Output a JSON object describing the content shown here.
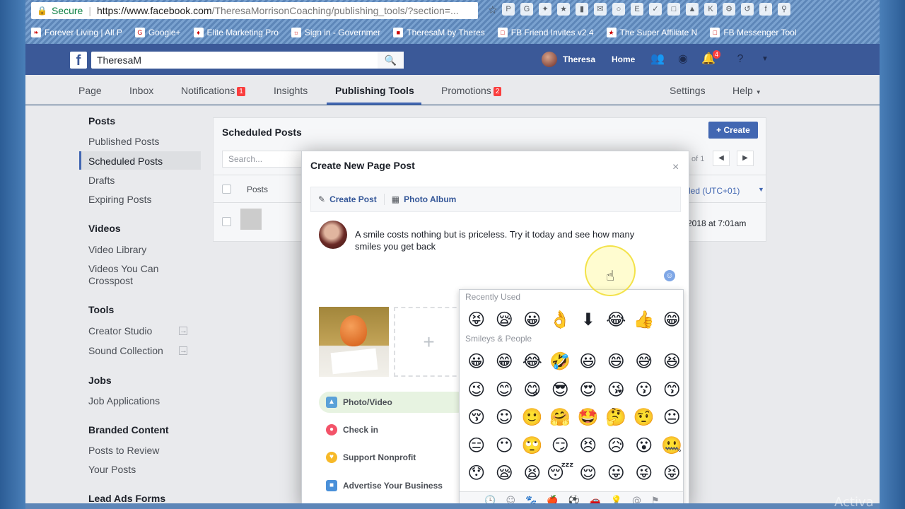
{
  "browser": {
    "secure_label": "Secure",
    "url_host": "https://www.facebook.com",
    "url_rest": "/TheresaMorrisonCoaching/publishing_tools/?section=...",
    "bookmarks": [
      "Forever Living | All P",
      "Google+",
      "Elite Marketing Pro",
      "Sign in - Governmer",
      "TheresaM by Theres",
      "FB Friend Invites v2.4",
      "The Super Affiliate N",
      "FB Messenger Tool"
    ]
  },
  "topbar": {
    "search_value": "TheresaM",
    "user_name": "Theresa",
    "home_label": "Home",
    "notif_count": "4"
  },
  "tabs": {
    "page": "Page",
    "inbox": "Inbox",
    "notifications": "Notifications",
    "notifications_badge": "1",
    "insights": "Insights",
    "publishing_tools": "Publishing Tools",
    "promotions": "Promotions",
    "promotions_badge": "2",
    "settings": "Settings",
    "help": "Help"
  },
  "sidebar": {
    "posts_head": "Posts",
    "published": "Published Posts",
    "scheduled": "Scheduled Posts",
    "drafts": "Drafts",
    "expiring": "Expiring Posts",
    "videos_head": "Videos",
    "video_library": "Video Library",
    "crosspost": "Videos You Can Crosspost",
    "tools_head": "Tools",
    "creator_studio": "Creator Studio",
    "sound_collection": "Sound Collection",
    "jobs_head": "Jobs",
    "job_applications": "Job Applications",
    "branded_head": "Branded Content",
    "posts_to_review": "Posts to Review",
    "your_posts": "Your Posts",
    "lead_ads_head": "Lead Ads Forms"
  },
  "panel": {
    "title": "Scheduled Posts",
    "create_label": "+ Create",
    "search_placeholder": "Search...",
    "col_posts": "Posts",
    "pager_text": "of 1",
    "timezone": "led (UTC+01)",
    "row_date": "2018 at 7:01am"
  },
  "modal": {
    "title": "Create New Page Post",
    "tab_create": "Create Post",
    "tab_album": "Photo Album",
    "post_text": "A smile costs nothing but is priceless. Try it today and see how many smiles you get back",
    "actions": [
      "Photo/Video",
      "Check in",
      "Support Nonprofit",
      "Advertise Your Business"
    ]
  },
  "picker": {
    "recent_label": "Recently Used",
    "smileys_label": "Smileys & People",
    "recent": [
      "😝",
      "😪",
      "😀",
      "👌",
      "⬇",
      "😂",
      "👍",
      "😁"
    ],
    "smileys": [
      [
        "😀",
        "😁",
        "😂",
        "🤣",
        "😃",
        "😄",
        "😅",
        "😆"
      ],
      [
        "😉",
        "😊",
        "😋",
        "😎",
        "😍",
        "😘",
        "😗",
        "😙"
      ],
      [
        "😚",
        "☺",
        "🙂",
        "🤗",
        "🤩",
        "🤔",
        "🤨",
        "😐"
      ],
      [
        "😑",
        "😶",
        "🙄",
        "😏",
        "😣",
        "😥",
        "😮",
        "🤐"
      ],
      [
        "😯",
        "😪",
        "😫",
        "😴",
        "😌",
        "😛",
        "😜",
        "😝"
      ]
    ],
    "categories": [
      "🕒",
      "☺",
      "🐾",
      "🍎",
      "⚽",
      "🚗",
      "💡",
      "@",
      "⚑"
    ]
  },
  "watermark": "Activa"
}
